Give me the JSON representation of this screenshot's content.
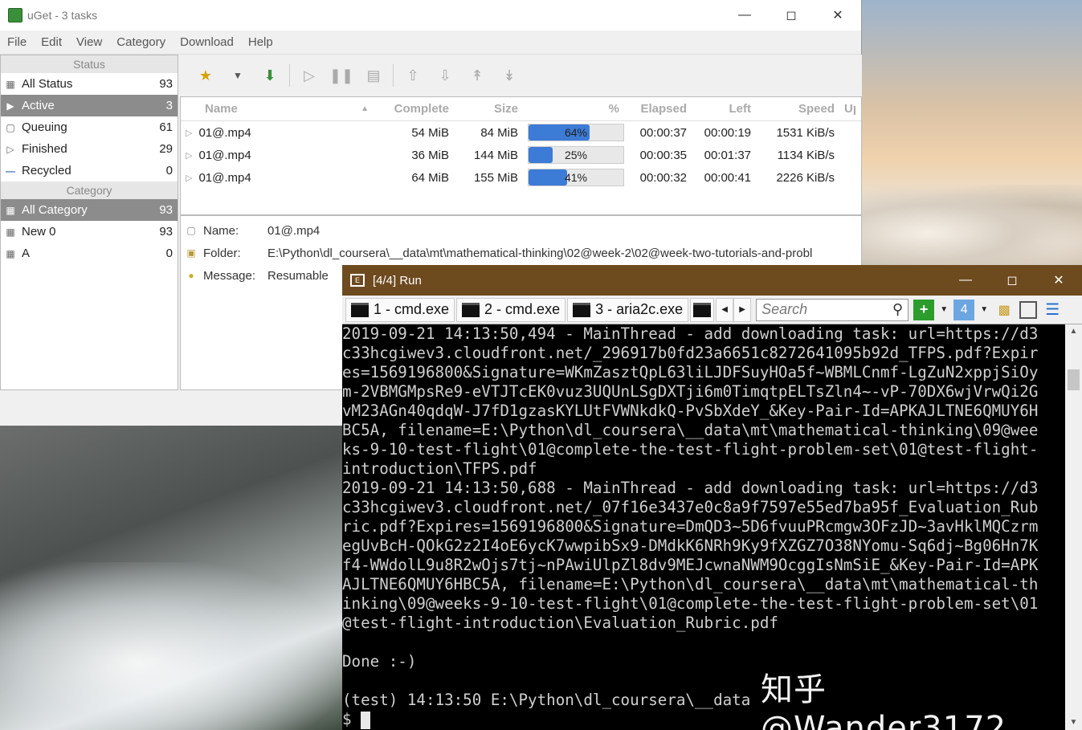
{
  "uget": {
    "window_title": "uGet - 3 tasks",
    "menu": [
      "File",
      "Edit",
      "View",
      "Category",
      "Download",
      "Help"
    ],
    "status_header": "Status",
    "status_items": [
      {
        "label": "All Status",
        "count": "93"
      },
      {
        "label": "Active",
        "count": "3"
      },
      {
        "label": "Queuing",
        "count": "61"
      },
      {
        "label": "Finished",
        "count": "29"
      },
      {
        "label": "Recycled",
        "count": "0"
      }
    ],
    "category_header": "Category",
    "category_items": [
      {
        "label": "All Category",
        "count": "93"
      },
      {
        "label": "New 0",
        "count": "93"
      },
      {
        "label": "A",
        "count": "0"
      }
    ],
    "columns": {
      "name": "Name",
      "complete": "Complete",
      "size": "Size",
      "percent": "%",
      "elapsed": "Elapsed",
      "left": "Left",
      "speed": "Speed",
      "up": "Up"
    },
    "tasks": [
      {
        "name": "01@.mp4",
        "complete": "54 MiB",
        "size": "84 MiB",
        "progress": 0.64,
        "progress_label": "64%",
        "elapsed": "00:00:37",
        "left": "00:00:19",
        "speed": "1531 KiB/s"
      },
      {
        "name": "01@.mp4",
        "complete": "36 MiB",
        "size": "144 MiB",
        "progress": 0.25,
        "progress_label": "25%",
        "elapsed": "00:00:35",
        "left": "00:01:37",
        "speed": "1134 KiB/s"
      },
      {
        "name": "01@.mp4",
        "complete": "64 MiB",
        "size": "155 MiB",
        "progress": 0.41,
        "progress_label": "41%",
        "elapsed": "00:00:32",
        "left": "00:00:41",
        "speed": "2226 KiB/s"
      }
    ],
    "details": {
      "name_label": "Name:",
      "name_value": "01@.mp4",
      "folder_label": "Folder:",
      "folder_value": "E:\\Python\\dl_coursera\\__data\\mt\\mathematical-thinking\\02@week-2\\02@week-two-tutorials-and-probl",
      "message_label": "Message:",
      "message_value": "Resumable"
    }
  },
  "console": {
    "window_title": "[4/4] Run",
    "tabs": [
      "1 - cmd.exe",
      "2 - cmd.exe",
      "3 - aria2c.exe"
    ],
    "search_placeholder": "Search",
    "tab_count_badge": "4",
    "lines": [
      "2019-09-21 14:13:50,494 - MainThread - add downloading task: url=https://d3",
      "c33hcgiwev3.cloudfront.net/_296917b0fd23a6651c8272641095b92d_TFPS.pdf?Expir",
      "es=1569196800&Signature=WKmZasztQpL63liLJDFSuyHOa5f~WBMLCnmf-LgZuN2xppjSiOy",
      "m-2VBMGMpsRe9-eVTJTcEK0vuz3UQUnLSgDXTji6m0TimqtpELTsZln4~-vP-70DX6wjVrwQi2G",
      "vM23AGn40qdqW-J7fD1gzasKYLUtFVWNkdkQ-PvSbXdeY_&Key-Pair-Id=APKAJLTNE6QMUY6H",
      "BC5A, filename=E:\\Python\\dl_coursera\\__data\\mt\\mathematical-thinking\\09@wee",
      "ks-9-10-test-flight\\01@complete-the-test-flight-problem-set\\01@test-flight-",
      "introduction\\TFPS.pdf",
      "2019-09-21 14:13:50,688 - MainThread - add downloading task: url=https://d3",
      "c33hcgiwev3.cloudfront.net/_07f16e3437e0c8a9f7597e55ed7ba95f_Evaluation_Rub",
      "ric.pdf?Expires=1569196800&Signature=DmQD3~5D6fvuuPRcmgw3OFzJD~3avHklMQCzrm",
      "egUvBcH-QOkG2z2I4oE6ycK7wwpibSx9-DMdkK6NRh9Ky9fXZGZ7O38NYomu-Sq6dj~Bg06Hn7K",
      "f4-WWdolL9u8R2wOjs7tj~nPAwiUlpZl8dv9MEJcwnaNWM9OcggIsNmSiE_&Key-Pair-Id=APK",
      "AJLTNE6QMUY6HBC5A, filename=E:\\Python\\dl_coursera\\__data\\mt\\mathematical-th",
      "inking\\09@weeks-9-10-test-flight\\01@complete-the-test-flight-problem-set\\01",
      "@test-flight-introduction\\Evaluation_Rubric.pdf",
      "",
      "Done :-)",
      "",
      "(test) 14:13:50 E:\\Python\\dl_coursera\\__data"
    ],
    "prompt": "$ "
  },
  "watermark": "知乎 @Wander3172"
}
